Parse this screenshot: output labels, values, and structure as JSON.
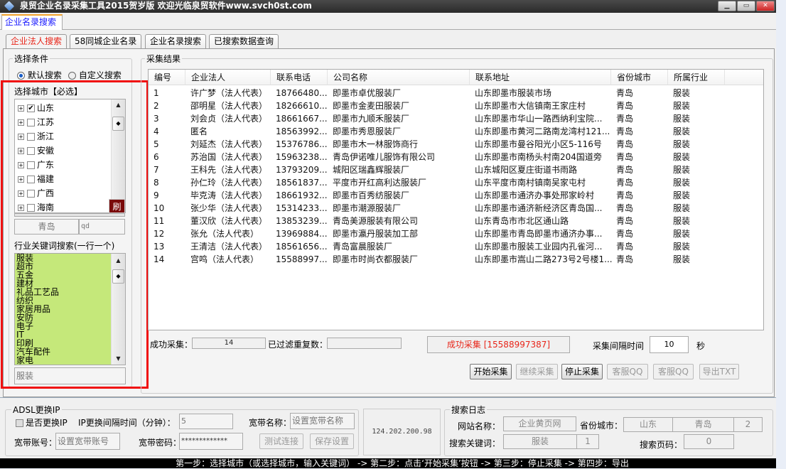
{
  "window": {
    "title": "泉贸企业名录采集工具2015贺岁版 欢迎光临泉贸软件www.svch0st.com",
    "controls": [
      "minimize",
      "maximize",
      "close"
    ]
  },
  "top_tab": "企业名录搜索",
  "sub_tabs": [
    "企业法人搜索",
    "58同城企业名录",
    "企业名录搜索",
    "已搜索数据查询"
  ],
  "left": {
    "group_title": "选择条件",
    "radio_default": "默认搜索",
    "radio_custom": "自定义搜索",
    "radio_selected": "默认搜索",
    "city_label": "选择城市【必选】",
    "provinces": [
      {
        "name": "山东",
        "checked": true
      },
      {
        "name": "江苏",
        "checked": false
      },
      {
        "name": "浙江",
        "checked": false
      },
      {
        "name": "安徽",
        "checked": false
      },
      {
        "name": "广东",
        "checked": false
      },
      {
        "name": "福建",
        "checked": false
      },
      {
        "name": "广西",
        "checked": false
      },
      {
        "name": "海南",
        "checked": false
      }
    ],
    "refresh_button": "刷",
    "city_value": "青岛",
    "city_code": "qd",
    "keyword_label": "行业关键词搜索(一行一个)",
    "keywords": "服装\n超市\n五金\n建材\n礼品工艺品\n纺织\n家居用品\n安防\n电子\nIT\n印刷\n汽车配件\n家电",
    "keyword_current": "服装"
  },
  "results": {
    "group_title": "采集结果",
    "columns": [
      "编号",
      "企业法人",
      "联系电话",
      "公司名称",
      "联系地址",
      "省份城市",
      "所属行业"
    ],
    "rows": [
      [
        "1",
        "许广梦（法人代表）",
        "18766480...",
        "即墨市卓优服装厂",
        "山东即墨市服装市场",
        "青岛",
        "服装"
      ],
      [
        "2",
        "邵明星（法人代表）",
        "18266610...",
        "即墨市金麦田服装厂",
        "山东即墨市大信镇南王家庄村",
        "青岛",
        "服装"
      ],
      [
        "3",
        "刘会贞（法人代表）",
        "18661667...",
        "即墨市九顺禾服装厂",
        "山东即墨市华山一路西纳利宝院...",
        "青岛",
        "服装"
      ],
      [
        "4",
        "匿名",
        "18563992...",
        "即墨市秀恩服装厂",
        "山东即墨市黄河二路南龙湾村121...",
        "青岛",
        "服装"
      ],
      [
        "5",
        "刘延杰（法人代表）",
        "15376786...",
        "即墨市木一林服饰商行",
        "山东即墨市曼谷阳光小区5-116号",
        "青岛",
        "服装"
      ],
      [
        "6",
        "苏治国（法人代表）",
        "15963238...",
        "青岛伊诺唯儿服饰有限公司",
        "山东即墨市南杨头村南204国道旁",
        "青岛",
        "服装"
      ],
      [
        "7",
        "王科先（法人代表）",
        "13793209...",
        "城阳区瑞鑫辉服装厂",
        "山东城阳区夏庄街道书雨路",
        "青岛",
        "服装"
      ],
      [
        "8",
        "孙仁玲（法人代表）",
        "18561837...",
        "平度市开红高利达服装厂",
        "山东平度市南村镇南吴家屯村",
        "青岛",
        "服装"
      ],
      [
        "9",
        "毕克涛（法人代表）",
        "18661932...",
        "即墨市百秀纺服装厂",
        "山东即墨市通济办事处邢家岭村",
        "青岛",
        "服装"
      ],
      [
        "10",
        "张少华（法人代表）",
        "15314233...",
        "即墨市潮源服装厂",
        "山东即墨市通济新经济区青岛国...",
        "青岛",
        "服装"
      ],
      [
        "11",
        "董汉欣（法人代表）",
        "13853239...",
        "青岛美源服装有限公司",
        "山东青岛市市北区通山路",
        "青岛",
        "服装"
      ],
      [
        "12",
        "张允（法人代表）",
        "13969884...",
        "即墨市瀛丹服装加工部",
        "山东即墨市青岛即墨市通济办事...",
        "青岛",
        "服装"
      ],
      [
        "13",
        "王清洁（法人代表）",
        "18561656...",
        "青岛富晨服装厂",
        "山东即墨市服装工业园内孔雀河...",
        "青岛",
        "服装"
      ],
      [
        "14",
        "宫鸣（法人代表）",
        "15588997...",
        "即墨市时尚衣都服装厂",
        "山东即墨市嵩山二路273号2号楼1...",
        "青岛",
        "服装"
      ]
    ],
    "success_label": "成功采集：",
    "success_count": "14",
    "filtered_label": "已过滤重复数：",
    "filtered_count": "",
    "status_message": "成功采集 [15588997387]",
    "status_color": "#e8261a",
    "interval_label": "采集间隔时间",
    "interval_value": "10",
    "interval_unit": "秒",
    "buttons": [
      {
        "label": "开始采集",
        "enabled": true
      },
      {
        "label": "继续采集",
        "enabled": false
      },
      {
        "label": "停止采集",
        "enabled": true
      },
      {
        "label": "客服QQ",
        "enabled": false
      },
      {
        "label": "客服QQ",
        "enabled": false
      },
      {
        "label": "导出TXT",
        "enabled": false
      }
    ]
  },
  "adsl": {
    "title": "ADSL更换IP",
    "change_ip_label": "是否更换IP",
    "change_ip_checked": false,
    "interval_label": "IP更换间隔时间（分钟）：",
    "interval_value": "5",
    "name_label": "宽带名称：",
    "name_placeholder": "设置宽带名称",
    "account_label": "宽带账号：",
    "account_placeholder": "设置宽带账号",
    "password_label": "宽带密码：",
    "password_value": "*************",
    "test_button": "测试连接",
    "save_button": "保存设置",
    "ip": "124.202.200.98"
  },
  "log": {
    "title": "搜索日志",
    "site_label": "网站名称：",
    "site_value": "企业黄页网",
    "city_label": "省份城市：",
    "province": "山东",
    "city": "青岛",
    "city_count": "2",
    "keyword_label": "搜索关键词：",
    "keyword": "服装",
    "keyword_count": "1",
    "page_label": "搜索页码：",
    "page": "0"
  },
  "status_bar": "第一步：选择城市（或选择城市，输入关键词） -> 第二步：点击‘开始采集’按钮  -> 第三步：停止采集  -> 第四步：导出"
}
